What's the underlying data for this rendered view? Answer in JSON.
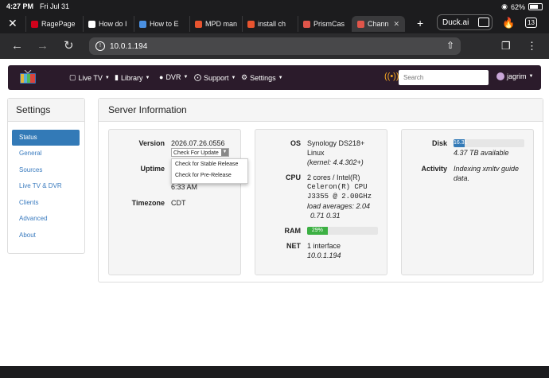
{
  "status_bar": {
    "time": "4:27 PM",
    "date": "Fri Jul 31",
    "battery": "62%"
  },
  "tabs": [
    {
      "label": "RagePage",
      "color": "#d0021b"
    },
    {
      "label": "How do I",
      "color": "#ffffff"
    },
    {
      "label": "How to E",
      "color": "#4a90e2"
    },
    {
      "label": "MPD man",
      "color": "#e8542f"
    },
    {
      "label": "install ch",
      "color": "#e8542f"
    },
    {
      "label": "PrismCas",
      "color": "#e0554a"
    },
    {
      "label": "Chann",
      "color": "#e0554a",
      "active": true
    }
  ],
  "browser": {
    "duck_label": "Duck.ai",
    "tab_count": "13",
    "url": "10.0.1.194"
  },
  "app": {
    "nav": {
      "live_tv": "Live TV",
      "library": "Library",
      "dvr": "DVR",
      "support": "Support",
      "settings": "Settings",
      "search_placeholder": "Search",
      "user": "jagrim"
    },
    "sidebar": {
      "title": "Settings",
      "items": [
        "Status",
        "General",
        "Sources",
        "Live TV & DVR",
        "Clients",
        "Advanced",
        "About"
      ]
    },
    "server": {
      "title": "Server Information",
      "version_label": "Version",
      "version": "2026.07.26.0556",
      "update_select": "Check For Update",
      "update_options": [
        "Check for Stable Release",
        "Check for Pre-Release"
      ],
      "uptime_label": "Uptime",
      "uptime": "6:33 AM",
      "timezone_label": "Timezone",
      "timezone": "CDT",
      "os_label": "OS",
      "os_line1": "Synology DS218+",
      "os_line2": "Linux",
      "os_kernel": "(kernel: 4.4.302+)",
      "cpu_label": "CPU",
      "cpu_line1": "2 cores / Intel(R)",
      "cpu_line2": "Celeron(R) CPU",
      "cpu_line3": "J3355 @ 2.00GHz",
      "cpu_load1": "load averages:  2.04",
      "cpu_load2": "0.71  0.31",
      "ram_label": "RAM",
      "ram_percent": 29,
      "ram_text": "29%",
      "net_label": "NET",
      "net_line1": "1 interface",
      "net_line2": "10.0.1.194",
      "disk_label": "Disk",
      "disk_percent": 16,
      "disk_text": "16.31",
      "disk_available": "4.37 TB available",
      "activity_label": "Activity",
      "activity_line1": "Indexing xmltv guide",
      "activity_line2": "data."
    }
  },
  "colors": {
    "navbar": "#2b1b2b",
    "accent": "#337ab7",
    "ram_bar": "#3cb043",
    "disk_bar": "#337ab7",
    "warn_icon": "#f5a623"
  }
}
